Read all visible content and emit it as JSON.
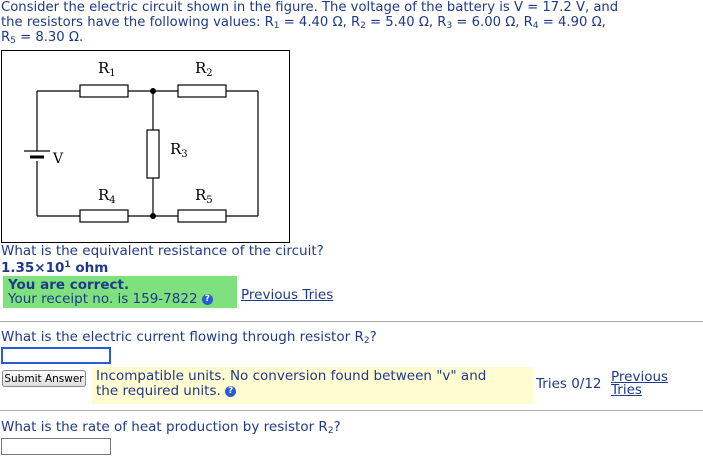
{
  "problem": {
    "intro_line1": "Consider the electric circuit shown in the figure. The voltage of the battery is V = 17.2 V, and",
    "intro_line2_prefix": "the resistors have the following values: R",
    "r1_sub": "1",
    "r1_val": " = 4.40 Ω, R",
    "r2_sub": "2",
    "r2_val": " = 5.40 Ω, R",
    "r3_sub": "3",
    "r3_val": " = 6.00 Ω, R",
    "r4_sub": "4",
    "r4_val": " = 4.90 Ω,",
    "line3_prefix": "R",
    "r5_sub": "5",
    "r5_val": " = 8.30 Ω."
  },
  "figure": {
    "label_R": "R",
    "r1": "1",
    "r2": "2",
    "r3": "3",
    "r4": "4",
    "r5": "5",
    "battery_label": "V"
  },
  "q1": {
    "question": "What is the equivalent resistance of the circuit?",
    "answer_mantissa": "1.35×10",
    "answer_exp": "1",
    "answer_unit": " ohm",
    "correct_title": "You are correct.",
    "receipt": "Your receipt no. is 159-7822",
    "previous_tries": "Previous Tries"
  },
  "q2": {
    "question_prefix": "What is the electric current flowing through resistor R",
    "question_sub": "2",
    "question_suffix": "?",
    "submit_label": "Submit Answer",
    "error_line1": "Incompatible units. No conversion found between \"v\" and",
    "error_line2": "the required units.",
    "tries": "Tries 0/12",
    "previous_line1": "Previous",
    "previous_line2": "Tries"
  },
  "q3": {
    "question_prefix": "What is the rate of heat production by resistor R",
    "question_sub": "2",
    "question_suffix": "?"
  },
  "colors": {
    "text": "#1f3a8a",
    "correct_bg": "#7ee17e",
    "warning_bg": "#fffcd2"
  }
}
